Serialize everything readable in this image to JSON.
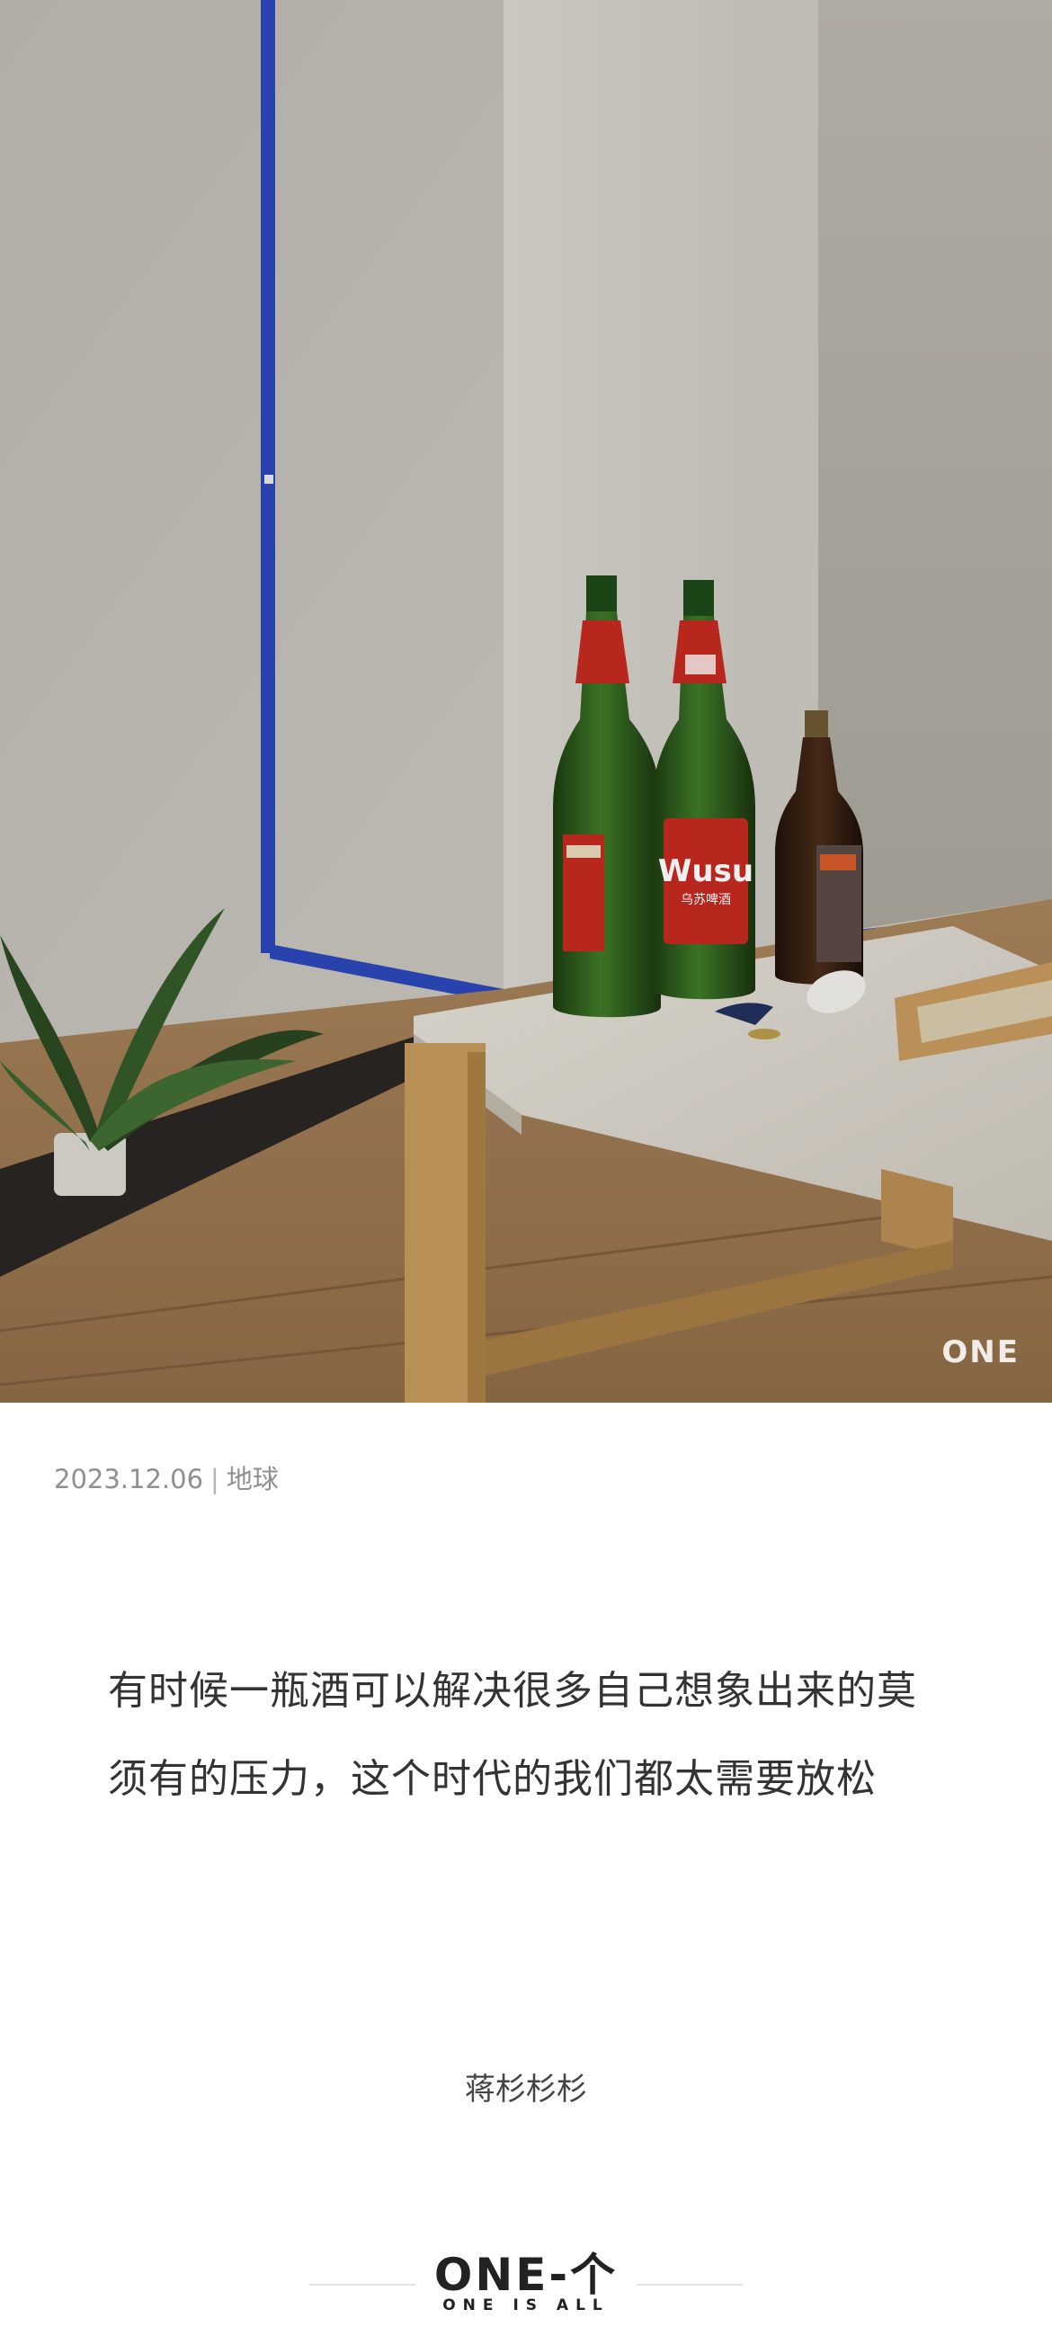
{
  "photo": {
    "alt_subject": "beer-bottles-on-table",
    "watermark": "ONE",
    "bottle_labels": {
      "brand": "Wusu",
      "subtitle": "乌苏啤酒"
    }
  },
  "meta": {
    "date": "2023.12.06",
    "separator": "|",
    "location": "地球"
  },
  "quote": {
    "lines": [
      "有时候一瓶酒可以解决很多自己想象出来的莫",
      "须有的压力，这个时代的我们都太需要放松"
    ]
  },
  "author": "蒋杉杉杉",
  "footer": {
    "brand": "ONE-个",
    "tagline": "ONE IS ALL"
  },
  "colors": {
    "wall": "#c9c6bf",
    "pipe": "#2b48b8",
    "table_top": "#d9d4ca",
    "wood": "#c49a5c",
    "bottle_green": "#2f5a1e",
    "label_red": "#c42a20"
  }
}
